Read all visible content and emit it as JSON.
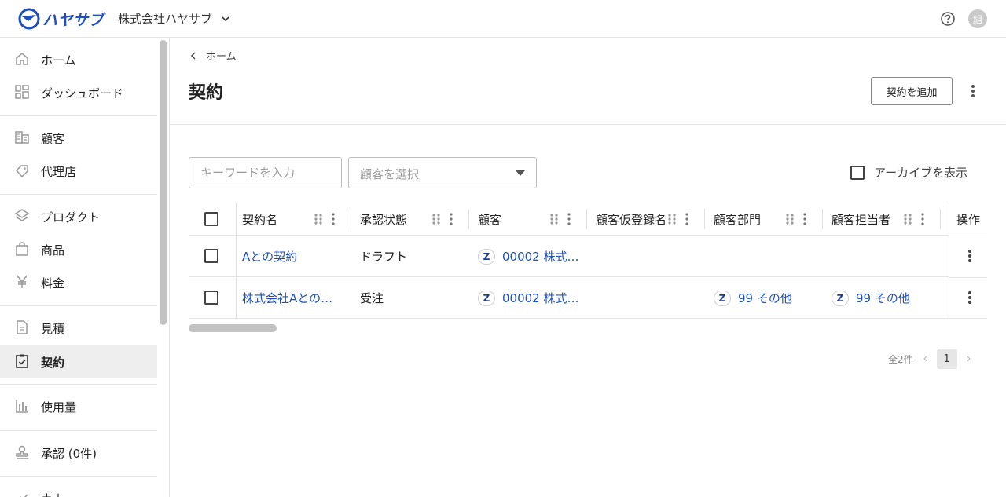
{
  "header": {
    "logo_text": "ハヤサブ",
    "company_name": "株式会社ハヤサブ",
    "avatar_text": "組"
  },
  "sidebar": {
    "items": [
      {
        "label": "ホーム",
        "icon": "home-icon"
      },
      {
        "label": "ダッシュボード",
        "icon": "dashboard-icon"
      },
      {
        "label": "顧客",
        "icon": "customer-icon"
      },
      {
        "label": "代理店",
        "icon": "agency-icon"
      },
      {
        "label": "プロダクト",
        "icon": "layers-icon"
      },
      {
        "label": "商品",
        "icon": "shopping-bag-icon"
      },
      {
        "label": "料金",
        "icon": "yen-icon"
      },
      {
        "label": "見積",
        "icon": "document-icon"
      },
      {
        "label": "契約",
        "icon": "clipboard-check-icon"
      },
      {
        "label": "使用量",
        "icon": "bar-chart-icon"
      },
      {
        "label": "承認 (0件)",
        "icon": "stamp-icon"
      },
      {
        "label": "売上",
        "icon": "sales-icon"
      }
    ],
    "active_index": 8
  },
  "main": {
    "breadcrumb": "ホーム",
    "title": "契約",
    "add_button": "契約を追加",
    "filters": {
      "keyword_placeholder": "キーワードを入力",
      "customer_placeholder": "顧客を選択",
      "archive_label": "アーカイブを表示"
    },
    "table": {
      "columns": [
        "契約名",
        "承認状態",
        "顧客",
        "顧客仮登録名",
        "顧客部門",
        "顧客担当者",
        "操作"
      ],
      "rows": [
        {
          "name": "Aとの契約",
          "status": "ドラフト",
          "customer": "00002 株式…",
          "customer_temp": "",
          "department": "",
          "contact": ""
        },
        {
          "name": "株式会社Aとの…",
          "status": "受注",
          "customer": "00002 株式…",
          "customer_temp": "",
          "department": "99 その他",
          "contact": "99 その他"
        }
      ],
      "badge": "Z"
    },
    "pagination": {
      "total": "全2件",
      "current_page": "1"
    }
  }
}
